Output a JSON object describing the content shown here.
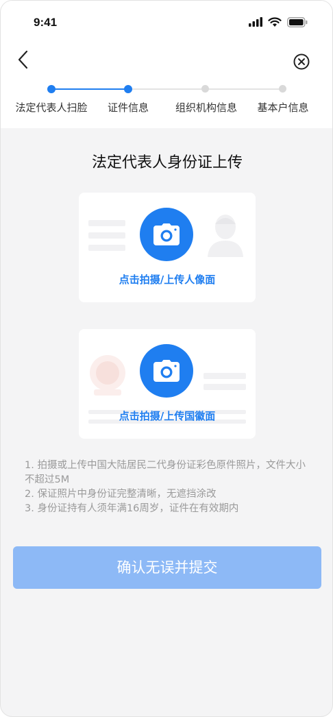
{
  "status": {
    "time": "9:41"
  },
  "icons": {
    "back": "chevron-left-icon",
    "close": "close-circle-icon",
    "camera": "camera-icon",
    "signal": "signal-icon",
    "wifi": "wifi-icon",
    "battery": "battery-icon"
  },
  "steps": [
    {
      "label": "法定代表人扫脸",
      "state": "done"
    },
    {
      "label": "证件信息",
      "state": "active"
    },
    {
      "label": "组织机构信息",
      "state": "pending"
    },
    {
      "label": "基本户信息",
      "state": "pending"
    }
  ],
  "colors": {
    "primary": "#1f7ef0",
    "disabled_button": "#8db9f6",
    "pending": "#d6d6d6"
  },
  "page": {
    "title": "法定代表人身份证上传"
  },
  "cards": {
    "portrait_label": "点击拍摄/上传人像面",
    "emblem_label": "点击拍摄/上传国徽面"
  },
  "notes": [
    "1. 拍摄或上传中国大陆居民二代身份证彩色原件照片，文件大小不超过5M",
    "2. 保证照片中身份证完整清晰，无遮挡涂改",
    "3. 身份证持有人须年满16周岁，证件在有效期内"
  ],
  "submit": {
    "label": "确认无误并提交",
    "enabled": false
  }
}
